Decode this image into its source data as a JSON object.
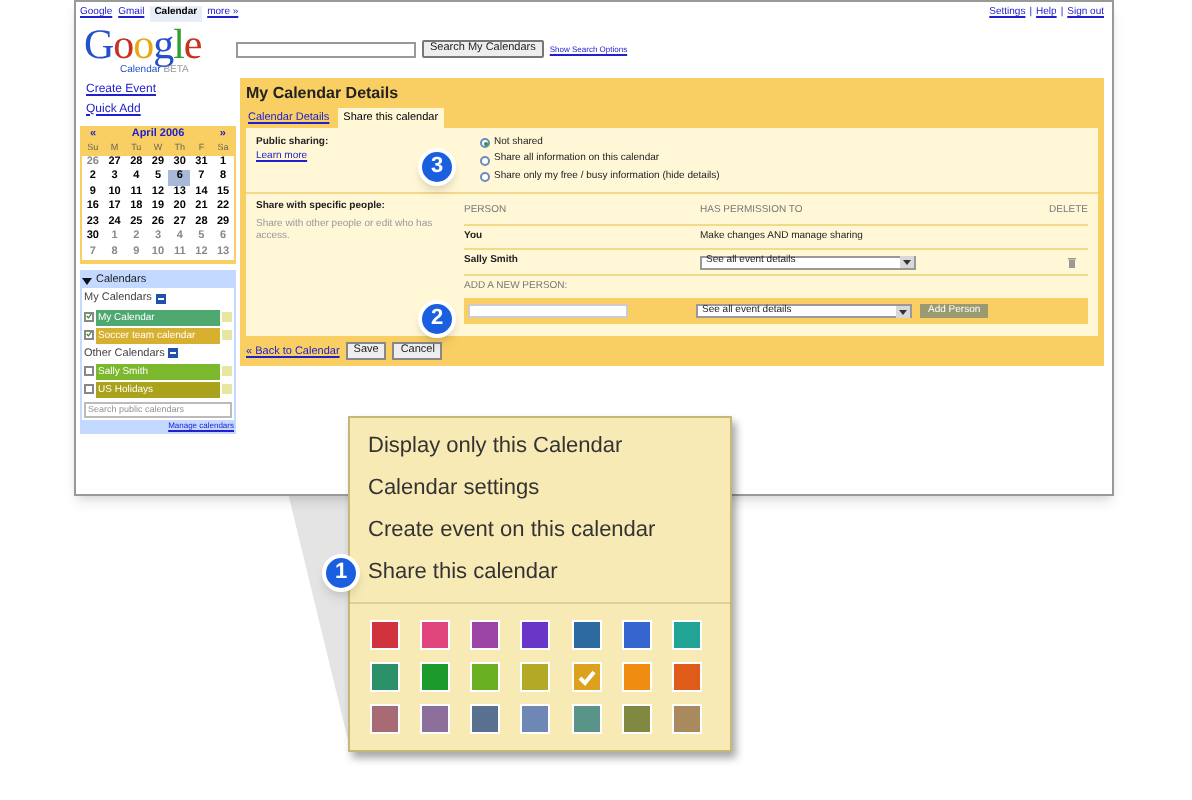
{
  "top_links": [
    {
      "label": "Google",
      "selected": false
    },
    {
      "label": "Gmail",
      "selected": false
    },
    {
      "label": "Calendar",
      "selected": true
    },
    {
      "label": "more »",
      "selected": false
    }
  ],
  "account_links": [
    "Settings",
    "Help",
    "Sign out"
  ],
  "account_separator": "|",
  "logo": {
    "word": "Google",
    "sub": "Calendar",
    "beta": "BETA"
  },
  "search": {
    "button": "Search My Calendars",
    "options_link": "Show Search Options"
  },
  "sidebar": {
    "create_event": "Create Event",
    "quick_add": "Quick Add",
    "mini_calendar": {
      "prev": "«",
      "month": "April 2006",
      "next": "»",
      "weekdays": [
        "Su",
        "M",
        "Tu",
        "W",
        "Th",
        "F",
        "Sa"
      ],
      "weeks": [
        [
          {
            "day": "26",
            "other": true
          },
          {
            "day": "27",
            "other": false
          },
          {
            "day": "28",
            "other": false
          },
          {
            "day": "29",
            "other": false
          },
          {
            "day": "30",
            "other": false
          },
          {
            "day": "31",
            "other": false
          },
          {
            "day": "1",
            "other": false
          }
        ],
        [
          {
            "day": "2",
            "other": false
          },
          {
            "day": "3",
            "other": false
          },
          {
            "day": "4",
            "other": false
          },
          {
            "day": "5",
            "other": false
          },
          {
            "day": "6",
            "today": true,
            "other": false
          },
          {
            "day": "7",
            "other": false
          },
          {
            "day": "8",
            "other": false
          }
        ],
        [
          {
            "day": "9",
            "other": false
          },
          {
            "day": "10",
            "other": false
          },
          {
            "day": "11",
            "other": false
          },
          {
            "day": "12",
            "other": false
          },
          {
            "day": "13",
            "other": false
          },
          {
            "day": "14",
            "other": false
          },
          {
            "day": "15",
            "other": false
          }
        ],
        [
          {
            "day": "16",
            "other": false
          },
          {
            "day": "17",
            "other": false
          },
          {
            "day": "18",
            "other": false
          },
          {
            "day": "19",
            "other": false
          },
          {
            "day": "20",
            "other": false
          },
          {
            "day": "21",
            "other": false
          },
          {
            "day": "22",
            "other": false
          }
        ],
        [
          {
            "day": "23",
            "other": false
          },
          {
            "day": "24",
            "other": false
          },
          {
            "day": "25",
            "other": false
          },
          {
            "day": "26",
            "other": false
          },
          {
            "day": "27",
            "other": false
          },
          {
            "day": "28",
            "other": false
          },
          {
            "day": "29",
            "other": false
          }
        ],
        [
          {
            "day": "30",
            "other": false
          },
          {
            "day": "1",
            "other": true
          },
          {
            "day": "2",
            "other": true
          },
          {
            "day": "3",
            "other": true
          },
          {
            "day": "4",
            "other": true
          },
          {
            "day": "5",
            "other": true
          },
          {
            "day": "6",
            "other": true
          }
        ],
        [
          {
            "day": "7",
            "other": true
          },
          {
            "day": "8",
            "other": true
          },
          {
            "day": "9",
            "other": true
          },
          {
            "day": "10",
            "other": true
          },
          {
            "day": "11",
            "other": true
          },
          {
            "day": "12",
            "other": true
          },
          {
            "day": "13",
            "other": true
          }
        ]
      ]
    },
    "calendars_box": {
      "title": "Calendars",
      "expanded": true,
      "groups": [
        {
          "title": "My Calendars",
          "items": [
            {
              "name": "My Calendar",
              "checked": true,
              "color": "#4ea870"
            },
            {
              "name": "Soccer team calendar",
              "checked": true,
              "color": "#d8b030"
            }
          ]
        },
        {
          "title": "Other Calendars",
          "items": [
            {
              "name": "Sally Smith",
              "checked": false,
              "color": "#7cb82e"
            },
            {
              "name": "US Holidays",
              "checked": false,
              "color": "#a9a21a"
            }
          ]
        }
      ],
      "search_placeholder": "Search public calendars",
      "manage_link": "Manage calendars"
    }
  },
  "details": {
    "title": "My Calendar Details",
    "tabs": [
      {
        "label": "Calendar Details",
        "selected": false
      },
      {
        "label": "Share this calendar",
        "selected": true
      }
    ],
    "public_sharing": {
      "label": "Public sharing:",
      "learn_more": "Learn more",
      "options": [
        {
          "label": "Not shared",
          "selected": true
        },
        {
          "label": "Share all information on this calendar",
          "selected": false
        },
        {
          "label": "Share only my free / busy information (hide details)",
          "selected": false
        }
      ]
    },
    "specific": {
      "label": "Share with specific people:",
      "description": "Share with other people or edit who has access.",
      "columns": [
        "PERSON",
        "HAS PERMISSION TO",
        "DELETE"
      ],
      "rows": [
        {
          "person": "You",
          "permission": "Make changes AND manage sharing",
          "kind": "text"
        },
        {
          "person": "Sally Smith",
          "permission": "See all event details",
          "kind": "select"
        }
      ],
      "add_label": "ADD A NEW PERSON:",
      "add_permission": "See all event details",
      "add_button": "Add Person"
    },
    "back_link": "« Back to Calendar",
    "buttons": [
      "Save",
      "Cancel"
    ]
  },
  "callouts": [
    "3",
    "2",
    "1"
  ],
  "context_menu": {
    "items": [
      "Display only this Calendar",
      "Calendar settings",
      "Create event on this calendar",
      "Share this calendar"
    ],
    "swatches": [
      {
        "color": "#d0333c",
        "selected": false
      },
      {
        "color": "#e0457b",
        "selected": false
      },
      {
        "color": "#9c44a6",
        "selected": false
      },
      {
        "color": "#6a36c8",
        "selected": false
      },
      {
        "color": "#2d6aa0",
        "selected": false
      },
      {
        "color": "#3566d0",
        "selected": false
      },
      {
        "color": "#22a494",
        "selected": false
      },
      {
        "color": "#2c9068",
        "selected": false
      },
      {
        "color": "#1c9a2c",
        "selected": false
      },
      {
        "color": "#6ab023",
        "selected": false
      },
      {
        "color": "#b3a926",
        "selected": false
      },
      {
        "color": "#dca21e",
        "selected": true
      },
      {
        "color": "#f08c10",
        "selected": false
      },
      {
        "color": "#e05a1a",
        "selected": false
      },
      {
        "color": "#a86b76",
        "selected": false
      },
      {
        "color": "#8c6f9a",
        "selected": false
      },
      {
        "color": "#5a7090",
        "selected": false
      },
      {
        "color": "#6f87b5",
        "selected": false
      },
      {
        "color": "#5a9488",
        "selected": false
      },
      {
        "color": "#818842",
        "selected": false
      },
      {
        "color": "#a88a5e",
        "selected": false
      }
    ]
  }
}
